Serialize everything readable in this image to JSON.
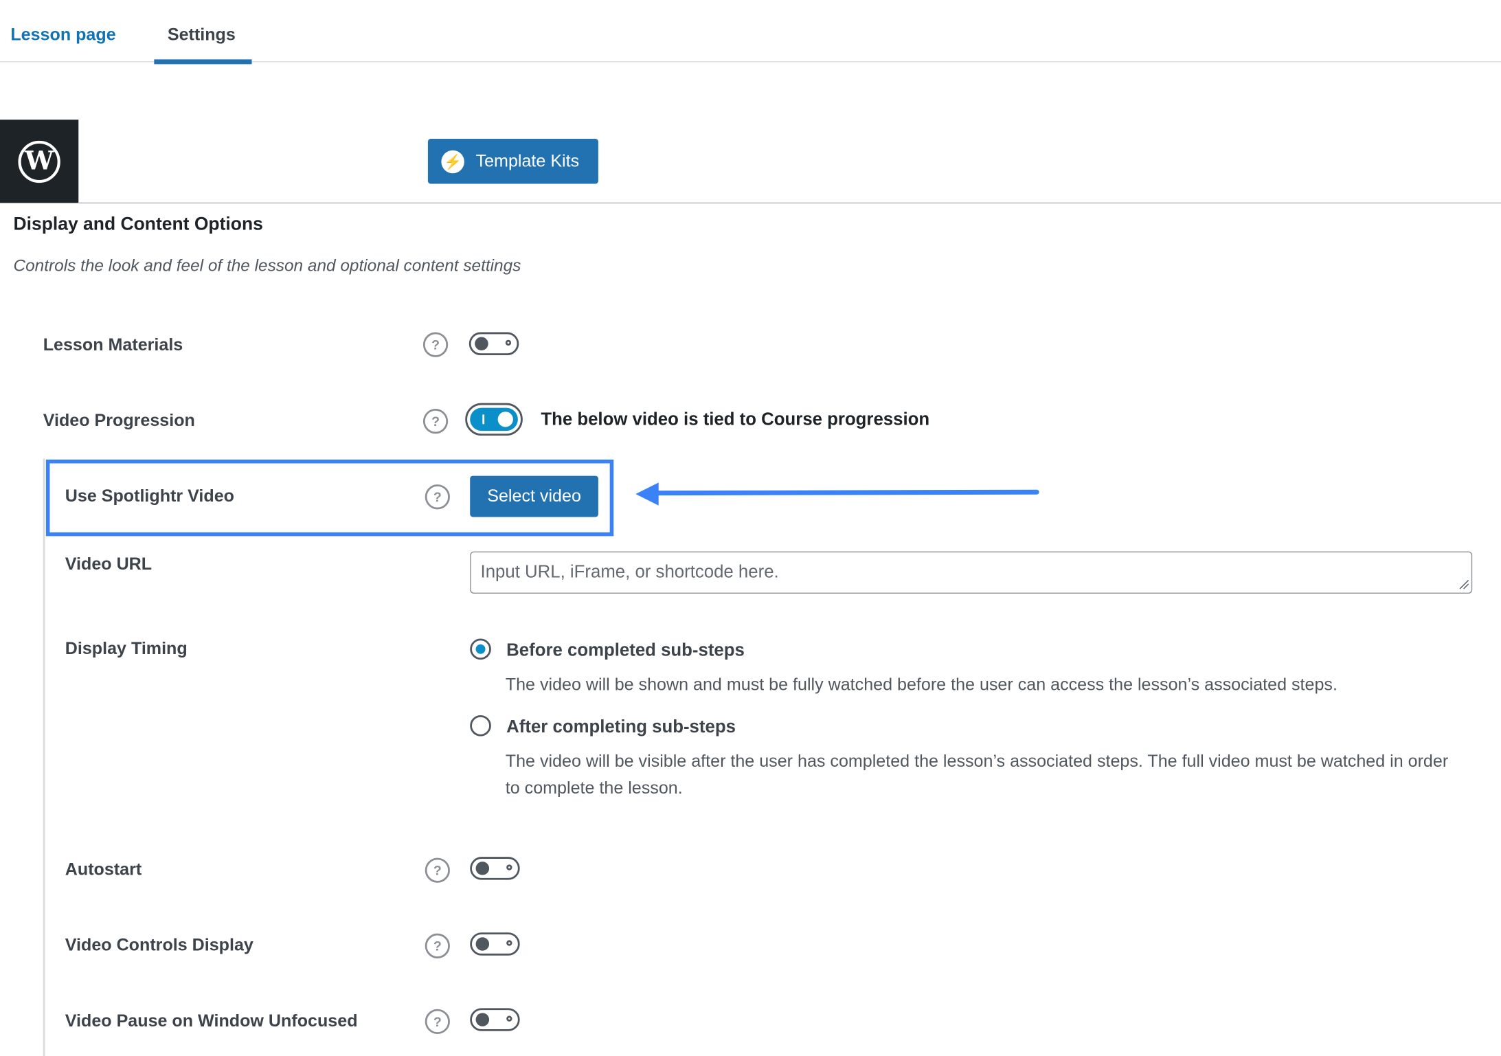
{
  "tabs": [
    {
      "label": "Lesson page"
    },
    {
      "label": "Settings"
    }
  ],
  "toolbar": {
    "template_kits_label": "Template Kits"
  },
  "section": {
    "title": "Display and Content Options",
    "description": "Controls the look and feel of the lesson and optional content settings"
  },
  "rows": {
    "lesson_materials": {
      "label": "Lesson Materials",
      "enabled": false
    },
    "video_progression": {
      "label": "Video Progression",
      "enabled": true,
      "note": "The below video is tied to Course progression"
    },
    "spotlightr": {
      "label": "Use Spotlightr Video",
      "button": "Select video"
    },
    "video_url": {
      "label": "Video URL",
      "placeholder": "Input URL, iFrame, or shortcode here.",
      "value": ""
    },
    "display_timing": {
      "label": "Display Timing",
      "options": [
        {
          "label": "Before completed sub-steps",
          "description": "The video will be shown and must be fully watched before the user can access the lesson’s associated steps.",
          "selected": true
        },
        {
          "label": "After completing sub-steps",
          "description": "The video will be visible after the user has completed the lesson’s associated steps. The full video must be watched in order to complete the lesson.",
          "selected": false
        }
      ]
    },
    "autostart": {
      "label": "Autostart",
      "enabled": false
    },
    "video_controls_display": {
      "label": "Video Controls Display",
      "enabled": false
    },
    "video_pause_unfocused": {
      "label": "Video Pause on Window Unfocused",
      "enabled": false
    }
  },
  "help_icon_glyph": "?",
  "colors": {
    "primary": "#2271b1",
    "toggle_on": "#0a8fc9",
    "highlight": "#3b82f6",
    "tab_active_text": "#1173b3"
  }
}
